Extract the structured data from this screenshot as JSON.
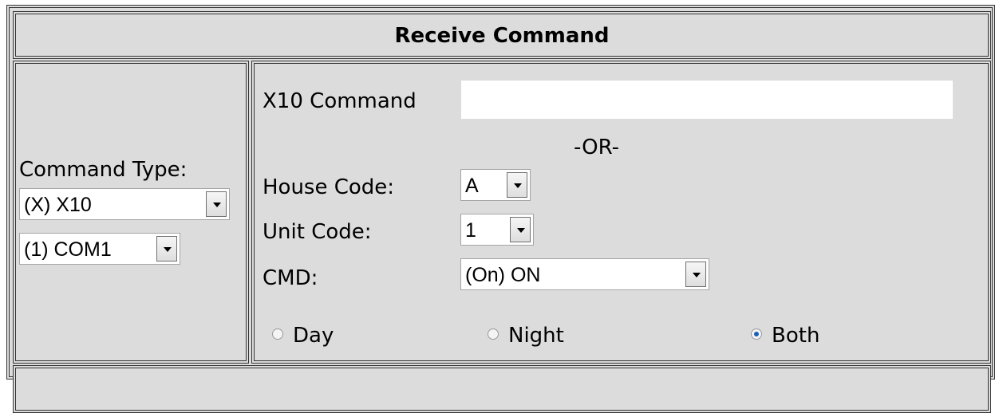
{
  "title": "Receive Command",
  "left": {
    "command_type_label": "Command Type:",
    "command_type_value": "(X) X10",
    "port_value": "(1) COM1"
  },
  "right": {
    "x10_command_label": "X10 Command",
    "x10_command_value": "",
    "or_label": "-OR-",
    "house_code_label": "House Code:",
    "house_code_value": "A",
    "unit_code_label": "Unit Code:",
    "unit_code_value": "1",
    "cmd_label": "CMD:",
    "cmd_value": "(On) ON",
    "radios": [
      {
        "label": "Day",
        "checked": false
      },
      {
        "label": "Night",
        "checked": false
      },
      {
        "label": "Both",
        "checked": true
      }
    ]
  },
  "icons": {
    "dropdown": "chevron-down-icon"
  },
  "colors": {
    "panel_bg": "#dcdcdc",
    "border": "#333333",
    "radio_selected": "#1d5fb8"
  }
}
